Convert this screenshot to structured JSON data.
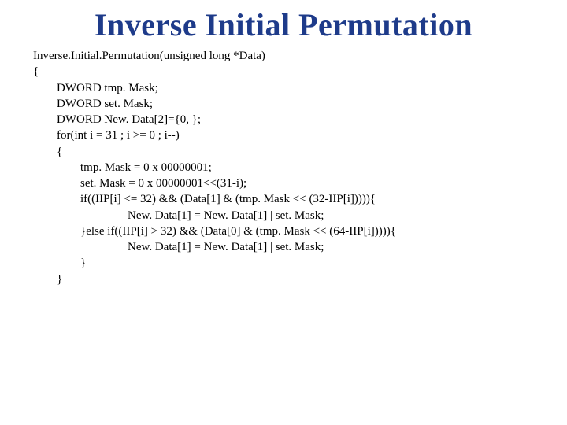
{
  "title": "Inverse Initial Permutation",
  "code": {
    "l00": "Inverse.Initial.Permutation(unsigned long *Data)",
    "l01": "{",
    "l02": "        DWORD tmp. Mask;",
    "l03": "        DWORD set. Mask;",
    "l04": "        DWORD New. Data[2]={0, };",
    "l05": "        for(int i = 31 ; i >= 0 ; i--)",
    "l06": "        {",
    "l07": "                tmp. Mask = 0 x 00000001;",
    "l08": "                set. Mask = 0 x 00000001<<(31-i);",
    "l09": "                if((IIP[i] <= 32) && (Data[1] & (tmp. Mask << (32-IIP[i])))){",
    "l10": "                                New. Data[1] = New. Data[1] | set. Mask;",
    "l11": "                }else if((IIP[i] > 32) && (Data[0] & (tmp. Mask << (64-IIP[i])))){",
    "l12": "                                New. Data[1] = New. Data[1] | set. Mask;",
    "l13": "                }",
    "l14": "        }"
  }
}
